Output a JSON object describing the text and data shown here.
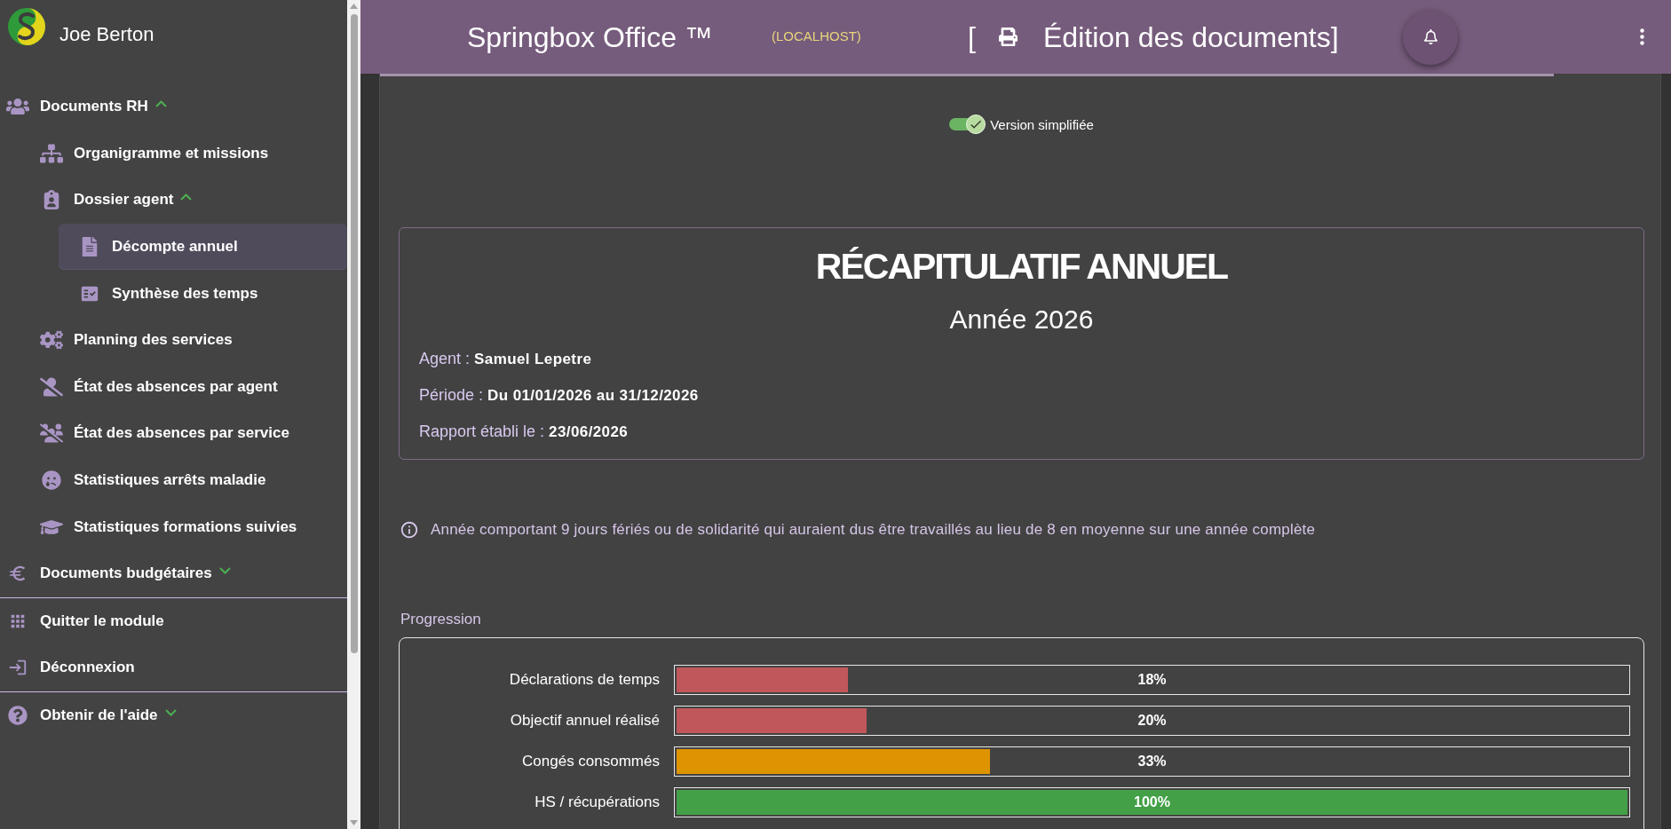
{
  "sidebar": {
    "user_name": "Joe Berton",
    "sections": [
      {
        "items": [
          {
            "label": "Documents RH",
            "expanded": true,
            "selected": false,
            "children": [
              {
                "label": "Organigramme et missions",
                "selected": false
              },
              {
                "label": "Dossier agent",
                "expanded": true,
                "selected": false,
                "children": [
                  {
                    "label": "Décompte annuel",
                    "selected": true
                  },
                  {
                    "label": "Synthèse des temps",
                    "selected": false
                  }
                ]
              },
              {
                "label": "Planning des services",
                "selected": false
              },
              {
                "label": "État des absences par agent",
                "selected": false
              },
              {
                "label": "État des absences par service",
                "selected": false
              },
              {
                "label": "Statistiques arrêts maladie",
                "selected": false
              },
              {
                "label": "Statistiques formations suivies",
                "selected": false
              }
            ]
          },
          {
            "label": "Documents budgétaires",
            "expanded": false,
            "selected": false
          }
        ]
      },
      {
        "items": [
          {
            "label": "Quitter le module",
            "selected": false
          },
          {
            "label": "Déconnexion",
            "selected": false
          }
        ]
      },
      {
        "items": [
          {
            "label": "Obtenir de l'aide",
            "expanded": false,
            "selected": false
          }
        ]
      }
    ]
  },
  "header": {
    "app_title": "Springbox Office ™",
    "host": "(LOCALHOST)",
    "bracket": "[",
    "page_title": "Édition des documents]"
  },
  "toggle": {
    "label": "Version simplifiée",
    "on": true
  },
  "summary": {
    "title": "RÉCAPITULATIF ANNUEL",
    "subtitle": "Année 2026",
    "fields": [
      {
        "label": "Agent :",
        "value": "Samuel Lepetre"
      },
      {
        "label": "Période :",
        "value": "Du 01/01/2026 au 31/12/2026"
      },
      {
        "label": "Rapport établi le :",
        "value": "23/06/2026"
      }
    ]
  },
  "info": {
    "text": "Année comportant 9 jours fériés ou de solidarité qui auraient dus être travaillés au lieu de 8 en moyenne sur une année complète"
  },
  "progression": {
    "title": "Progression",
    "bars": [
      {
        "label": "Déclarations de temps",
        "level": 0.18,
        "reading": "18%",
        "color": "#c0575a"
      },
      {
        "label": "Objectif annuel réalisé",
        "level": 0.2,
        "reading": "20%",
        "color": "#c0575a"
      },
      {
        "label": "Congés consommés",
        "level": 0.33,
        "reading": "33%",
        "color": "#de9400"
      },
      {
        "label": "HS / récupérations",
        "level": 1,
        "reading": "100%",
        "color": "#43a047"
      }
    ]
  }
}
